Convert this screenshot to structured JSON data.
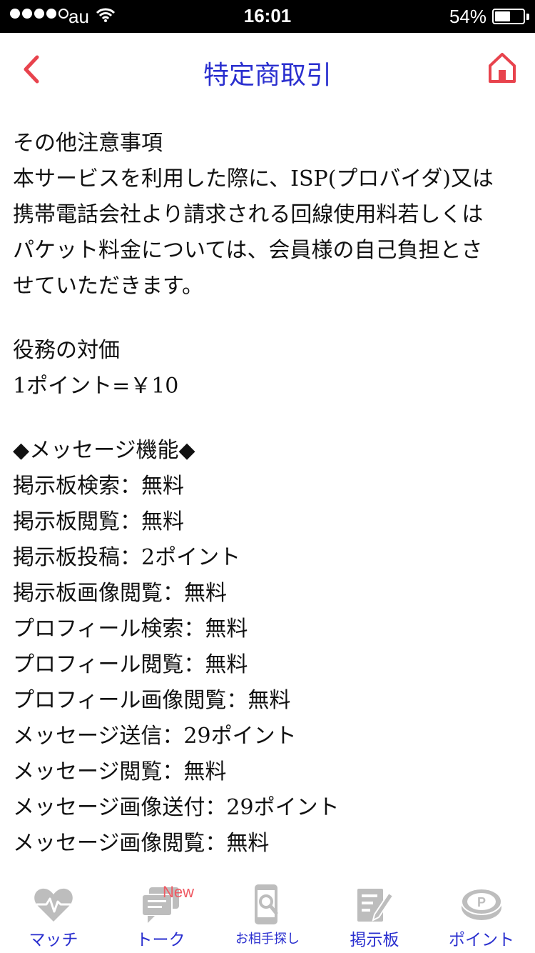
{
  "status_bar": {
    "carrier": "au",
    "time": "16:01",
    "battery_percent_text": "54%",
    "battery_level": 0.54
  },
  "nav": {
    "title": "特定商取引",
    "back_icon": "chevron-left-icon",
    "home_icon": "home-icon",
    "accent_color": "#e8434d",
    "title_color": "#2a2fcf"
  },
  "content": {
    "section1_title": "その他注意事項",
    "section1_line1": "本サービスを利用した際に、ISP(プロバイダ)又は",
    "section1_line2": "携帯電話会社より請求される回線使用料若しくは",
    "section1_line3": "パケット料金については、会員様の自己負担とさ",
    "section1_line4": "せていただきます。",
    "section2_title": "役務の対価",
    "section2_value": "1ポイント=￥10",
    "section3_title": "◆メッセージ機能◆",
    "items": [
      "掲示板検索：無料",
      "掲示板閲覧：無料",
      "掲示板投稿：2ポイント",
      "掲示板画像閲覧：無料",
      "プロフィール検索：無料",
      "プロフィール閲覧：無料",
      "プロフィール画像閲覧：無料",
      "メッセージ送信：29ポイント",
      "メッセージ閲覧：無料",
      "メッセージ画像送付：29ポイント",
      "メッセージ画像閲覧：無料"
    ]
  },
  "tab_bar": {
    "tabs": [
      {
        "label": "マッチ",
        "icon": "heart-pulse-icon"
      },
      {
        "label": "トーク",
        "icon": "chat-bubbles-icon",
        "badge": "New"
      },
      {
        "label": "お相手探し",
        "icon": "phone-search-icon"
      },
      {
        "label": "掲示板",
        "icon": "board-pen-icon"
      },
      {
        "label": "ポイント",
        "icon": "point-coin-icon"
      }
    ],
    "icon_color": "#bdbdbd",
    "label_color": "#2a2fcf",
    "badge_color": "#ef5a63"
  }
}
